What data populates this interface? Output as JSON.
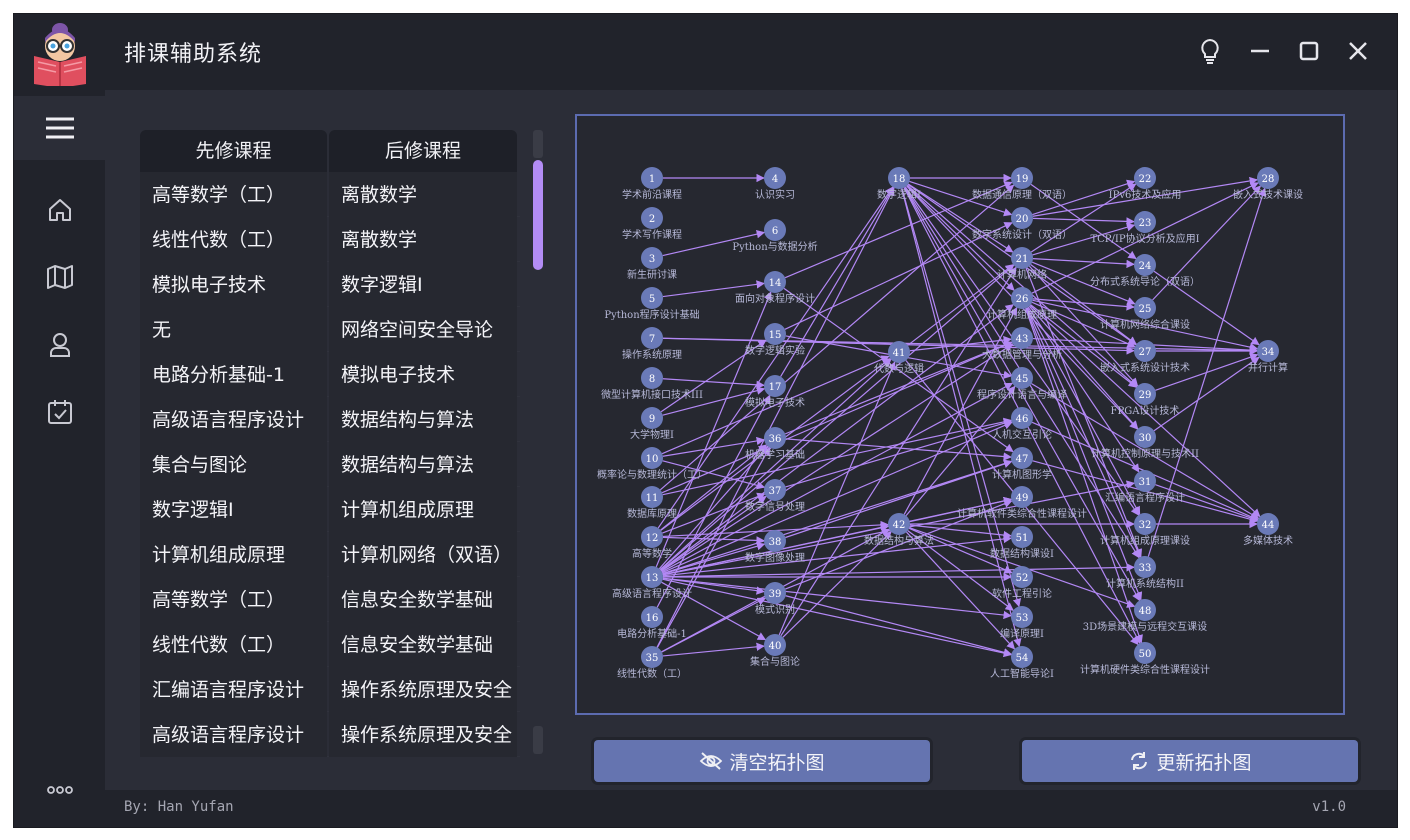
{
  "app": {
    "title": "排课辅助系统"
  },
  "nav": {
    "items": [
      "menu-icon",
      "home-icon",
      "map-icon",
      "user-icon",
      "calendar-check-icon",
      "more-icon"
    ]
  },
  "table": {
    "headers": [
      "先修课程",
      "后修课程"
    ],
    "rows": [
      [
        "高等数学（工）",
        "离散数学"
      ],
      [
        "线性代数（工）",
        "离散数学"
      ],
      [
        "模拟电子技术",
        "数字逻辑Ⅰ"
      ],
      [
        "无",
        "网络空间安全导论"
      ],
      [
        "电路分析基础-1",
        "模拟电子技术"
      ],
      [
        "高级语言程序设计",
        "数据结构与算法"
      ],
      [
        "集合与图论",
        "数据结构与算法"
      ],
      [
        "数字逻辑Ⅰ",
        "计算机组成原理"
      ],
      [
        "计算机组成原理",
        "计算机网络（双语）"
      ],
      [
        "高等数学（工）",
        "信息安全数学基础"
      ],
      [
        "线性代数（工）",
        "信息安全数学基础"
      ],
      [
        "汇编语言程序设计",
        "操作系统原理及安全"
      ],
      [
        "高级语言程序设计",
        "操作系统原理及安全"
      ]
    ]
  },
  "graph": {
    "edge_color": "#b388f5",
    "node_color": "#6a7ab8",
    "nodes": [
      {
        "id": "1",
        "label": "学术前沿课程"
      },
      {
        "id": "2",
        "label": "学术写作课程"
      },
      {
        "id": "3",
        "label": "新生研讨课"
      },
      {
        "id": "5",
        "label": "Python程序设计基础"
      },
      {
        "id": "7",
        "label": "操作系统原理"
      },
      {
        "id": "8",
        "label": "微型计算机接口技术III"
      },
      {
        "id": "9",
        "label": "大学物理Ⅰ"
      },
      {
        "id": "10",
        "label": "概率论与数理统计（工）"
      },
      {
        "id": "11",
        "label": "数据库原理"
      },
      {
        "id": "12",
        "label": "高等数学"
      },
      {
        "id": "13",
        "label": "高级语言程序设计"
      },
      {
        "id": "16",
        "label": "电路分析基础-1"
      },
      {
        "id": "35",
        "label": "线性代数（工）"
      },
      {
        "id": "4",
        "label": "认识实习"
      },
      {
        "id": "6",
        "label": "Python与数据分析"
      },
      {
        "id": "14",
        "label": "面向对象程序设计"
      },
      {
        "id": "15",
        "label": "数字逻辑实验"
      },
      {
        "id": "17",
        "label": "模拟电子技术"
      },
      {
        "id": "36",
        "label": "机器学习基础"
      },
      {
        "id": "37",
        "label": "数字信号处理"
      },
      {
        "id": "38",
        "label": "数字图像处理"
      },
      {
        "id": "39",
        "label": "模式识别"
      },
      {
        "id": "40",
        "label": "集合与图论"
      },
      {
        "id": "18",
        "label": "数字逻辑Ⅰ"
      },
      {
        "id": "41",
        "label": "代数与逻辑"
      },
      {
        "id": "42",
        "label": "数据结构与算法"
      },
      {
        "id": "19",
        "label": "数据通信原理（双语）"
      },
      {
        "id": "20",
        "label": "数字系统设计（双语）"
      },
      {
        "id": "21",
        "label": "计算机网络"
      },
      {
        "id": "26",
        "label": "计算机组成原理"
      },
      {
        "id": "43",
        "label": "大数据管理与分析"
      },
      {
        "id": "45",
        "label": "程序设计语言与编译"
      },
      {
        "id": "46",
        "label": "人机交互引论"
      },
      {
        "id": "47",
        "label": "计算机图形学"
      },
      {
        "id": "49",
        "label": "计算机软件类综合性课程设计"
      },
      {
        "id": "51",
        "label": "数据结构课设Ⅰ"
      },
      {
        "id": "52",
        "label": "软件工程引论"
      },
      {
        "id": "53",
        "label": "编译原理Ⅰ"
      },
      {
        "id": "54",
        "label": "人工智能导论Ⅰ"
      },
      {
        "id": "22",
        "label": "IPv6技术及应用"
      },
      {
        "id": "23",
        "label": "TCP/IP协议分析及应用Ⅰ"
      },
      {
        "id": "24",
        "label": "分布式系统导论（双语）"
      },
      {
        "id": "25",
        "label": "计算机网络综合课设"
      },
      {
        "id": "27",
        "label": "嵌入式系统设计技术"
      },
      {
        "id": "29",
        "label": "FPGA设计技术"
      },
      {
        "id": "30",
        "label": "计算机控制原理与技术II"
      },
      {
        "id": "31",
        "label": "汇编语言程序设计"
      },
      {
        "id": "32",
        "label": "计算机组成原理课设"
      },
      {
        "id": "33",
        "label": "计算机系统结构II"
      },
      {
        "id": "48",
        "label": "3D场景建模与远程交互课设"
      },
      {
        "id": "50",
        "label": "计算机硬件类综合性课程设计"
      },
      {
        "id": "28",
        "label": "嵌入式技术课设"
      },
      {
        "id": "34",
        "label": "并行计算"
      },
      {
        "id": "44",
        "label": "多媒体技术"
      }
    ],
    "edges": [
      [
        "1",
        "4"
      ],
      [
        "3",
        "6"
      ],
      [
        "5",
        "14"
      ],
      [
        "7",
        "34"
      ],
      [
        "7",
        "27"
      ],
      [
        "8",
        "17"
      ],
      [
        "9",
        "17"
      ],
      [
        "9",
        "15"
      ],
      [
        "10",
        "36"
      ],
      [
        "10",
        "37"
      ],
      [
        "10",
        "41"
      ],
      [
        "11",
        "43"
      ],
      [
        "11",
        "46"
      ],
      [
        "11",
        "19"
      ],
      [
        "12",
        "36"
      ],
      [
        "12",
        "37"
      ],
      [
        "12",
        "38"
      ],
      [
        "12",
        "41"
      ],
      [
        "12",
        "42"
      ],
      [
        "12",
        "18"
      ],
      [
        "13",
        "14"
      ],
      [
        "13",
        "36"
      ],
      [
        "13",
        "37"
      ],
      [
        "13",
        "38"
      ],
      [
        "13",
        "39"
      ],
      [
        "13",
        "40"
      ],
      [
        "13",
        "42"
      ],
      [
        "13",
        "41"
      ],
      [
        "13",
        "21"
      ],
      [
        "13",
        "26"
      ],
      [
        "13",
        "43"
      ],
      [
        "13",
        "45"
      ],
      [
        "13",
        "46"
      ],
      [
        "13",
        "47"
      ],
      [
        "13",
        "49"
      ],
      [
        "13",
        "51"
      ],
      [
        "13",
        "52"
      ],
      [
        "13",
        "53"
      ],
      [
        "13",
        "54"
      ],
      [
        "13",
        "31"
      ],
      [
        "13",
        "33"
      ],
      [
        "16",
        "17"
      ],
      [
        "35",
        "40"
      ],
      [
        "35",
        "42"
      ],
      [
        "35",
        "36"
      ],
      [
        "35",
        "39"
      ],
      [
        "35",
        "18"
      ],
      [
        "17",
        "18"
      ],
      [
        "15",
        "45"
      ],
      [
        "15",
        "20"
      ],
      [
        "14",
        "19"
      ],
      [
        "14",
        "47"
      ],
      [
        "36",
        "43"
      ],
      [
        "36",
        "47"
      ],
      [
        "37",
        "46"
      ],
      [
        "38",
        "47"
      ],
      [
        "39",
        "49"
      ],
      [
        "39",
        "54"
      ],
      [
        "40",
        "42"
      ],
      [
        "40",
        "41"
      ],
      [
        "40",
        "21"
      ],
      [
        "18",
        "19"
      ],
      [
        "18",
        "20"
      ],
      [
        "18",
        "21"
      ],
      [
        "18",
        "26"
      ],
      [
        "18",
        "27"
      ],
      [
        "18",
        "29"
      ],
      [
        "18",
        "30"
      ],
      [
        "18",
        "32"
      ],
      [
        "18",
        "33"
      ],
      [
        "18",
        "48"
      ],
      [
        "18",
        "50"
      ],
      [
        "18",
        "53"
      ],
      [
        "18",
        "54"
      ],
      [
        "41",
        "43"
      ],
      [
        "41",
        "21"
      ],
      [
        "41",
        "50"
      ],
      [
        "42",
        "49"
      ],
      [
        "42",
        "51"
      ],
      [
        "42",
        "52"
      ],
      [
        "42",
        "53"
      ],
      [
        "42",
        "54"
      ],
      [
        "42",
        "45"
      ],
      [
        "42",
        "26"
      ],
      [
        "42",
        "32"
      ],
      [
        "42",
        "48"
      ],
      [
        "19",
        "24"
      ],
      [
        "20",
        "22"
      ],
      [
        "20",
        "23"
      ],
      [
        "20",
        "28"
      ],
      [
        "21",
        "22"
      ],
      [
        "21",
        "23"
      ],
      [
        "21",
        "24"
      ],
      [
        "21",
        "25"
      ],
      [
        "21",
        "27"
      ],
      [
        "21",
        "29"
      ],
      [
        "21",
        "33"
      ],
      [
        "26",
        "25"
      ],
      [
        "26",
        "27"
      ],
      [
        "26",
        "28"
      ],
      [
        "26",
        "29"
      ],
      [
        "26",
        "30"
      ],
      [
        "26",
        "31"
      ],
      [
        "26",
        "32"
      ],
      [
        "26",
        "33"
      ],
      [
        "26",
        "34"
      ],
      [
        "26",
        "44"
      ],
      [
        "26",
        "48"
      ],
      [
        "26",
        "50"
      ],
      [
        "43",
        "34"
      ],
      [
        "45",
        "44"
      ],
      [
        "46",
        "44"
      ],
      [
        "47",
        "44"
      ],
      [
        "24",
        "34"
      ],
      [
        "27",
        "34"
      ],
      [
        "29",
        "34"
      ],
      [
        "31",
        "44"
      ],
      [
        "33",
        "28"
      ],
      [
        "32",
        "44"
      ],
      [
        "30",
        "34"
      ],
      [
        "25",
        "28"
      ]
    ]
  },
  "buttons": {
    "clear": "清空拓扑图",
    "update": "更新拓扑图"
  },
  "footer": {
    "author": "By: Han Yufan",
    "version": "v1.0"
  }
}
